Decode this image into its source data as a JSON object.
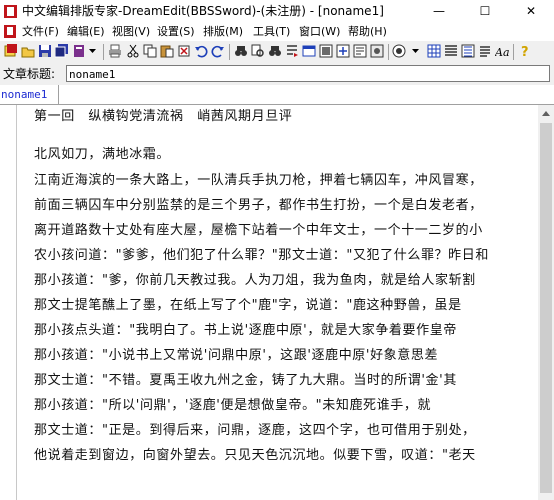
{
  "window": {
    "title": "中文编辑排版专家-DreamEdit(BBSSword)-(未注册) - [noname1]",
    "minimize_glyph": "—",
    "maximize_glyph": "☐",
    "close_glyph": "✕"
  },
  "menu": {
    "items": [
      "文件(F)",
      "编辑(E)",
      "视图(V)",
      "设置(S)",
      "排版(M)",
      "工具(T)",
      "窗口(W)",
      "帮助(H)"
    ]
  },
  "toolbar": {
    "icons": [
      "new-doc-icon",
      "open-folder-icon",
      "save-icon",
      "save-all-icon",
      "bookmark-icon",
      "print-icon",
      "cut-icon",
      "copy-icon",
      "paste-icon",
      "undo-icon",
      "redo-icon",
      "find-icon",
      "find-replace-icon",
      "find-next-icon",
      "goto-icon",
      "view-icon",
      "block-icon",
      "insert-icon",
      "format-icon",
      "settings-icon",
      "table-icon",
      "list-icon",
      "font-icon",
      "help-icon"
    ]
  },
  "title_field": {
    "label": "文章标题:",
    "value": "noname1"
  },
  "tabs": [
    {
      "label": "noname1"
    }
  ],
  "document": {
    "lines": [
      "第一回　纵横钩党清流祸　峭茜风期月旦评",
      "",
      "北风如刀，满地冰霜。",
      "江南近海滨的一条大路上，一队清兵手执刀枪，押着七辆囚车，冲风冒寒，",
      "前面三辆囚车中分别监禁的是三个男子，都作书生打扮，一个是白发老者，",
      "离开道路数十丈处有座大屋，屋檐下站着一个中年文士，一个十一二岁的小",
      "农小孩问道：\"爹爹，他们犯了什么罪？\"那文士道：\"又犯了什么罪？昨日和",
      "那小孩道：\"爹，你前几天教过我。人为刀俎，我为鱼肉，就是给人家斩割",
      "那文士提笔醮上了墨，在纸上写了个\"鹿\"字，说道：\"鹿这种野兽，虽是",
      "那小孩点头道：\"我明白了。书上说'逐鹿中原'，就是大家争着要作皇帝",
      "那小孩道：\"小说书上又常说'问鼎中原'，这跟'逐鹿中原'好象意思差",
      "那文士道：\"不错。夏禹王收九州之金，铸了九大鼎。当时的所谓'金'其",
      "那小孩道：\"所以'问鼎'，'逐鹿'便是想做皇帝。\"未知鹿死谁手，就",
      "那文士道：\"正是。到得后来，问鼎，逐鹿，这四个字，也可借用于别处，",
      "他说着走到窗边，向窗外望去。只见天色沉沉地。似要下雪，叹道：\"老天"
    ]
  }
}
